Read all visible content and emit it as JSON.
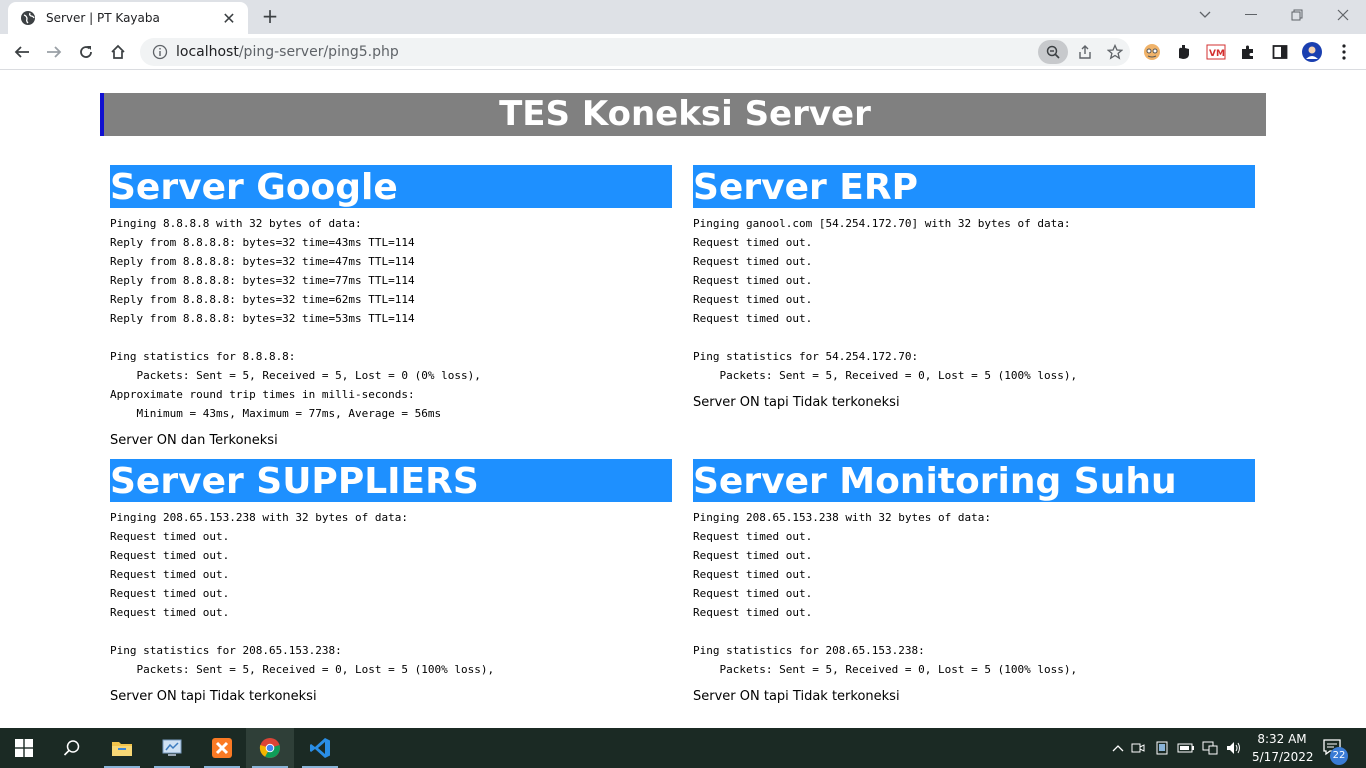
{
  "browser": {
    "tab_title": "Server | PT Kayaba",
    "url_host": "localhost",
    "url_path": "/ping-server/ping5.php"
  },
  "page": {
    "title": "TES Koneksi Server",
    "servers": [
      {
        "name": "Server Google",
        "output": "Pinging 8.8.8.8 with 32 bytes of data:\nReply from 8.8.8.8: bytes=32 time=43ms TTL=114\nReply from 8.8.8.8: bytes=32 time=47ms TTL=114\nReply from 8.8.8.8: bytes=32 time=77ms TTL=114\nReply from 8.8.8.8: bytes=32 time=62ms TTL=114\nReply from 8.8.8.8: bytes=32 time=53ms TTL=114\n\nPing statistics for 8.8.8.8:\n    Packets: Sent = 5, Received = 5, Lost = 0 (0% loss),\nApproximate round trip times in milli-seconds:\n    Minimum = 43ms, Maximum = 77ms, Average = 56ms",
        "status": "Server ON dan Terkoneksi"
      },
      {
        "name": "Server ERP",
        "output": "Pinging ganool.com [54.254.172.70] with 32 bytes of data:\nRequest timed out.\nRequest timed out.\nRequest timed out.\nRequest timed out.\nRequest timed out.\n\nPing statistics for 54.254.172.70:\n    Packets: Sent = 5, Received = 0, Lost = 5 (100% loss),",
        "status": "Server ON tapi Tidak terkoneksi"
      },
      {
        "name": "Server SUPPLIERS",
        "output": "Pinging 208.65.153.238 with 32 bytes of data:\nRequest timed out.\nRequest timed out.\nRequest timed out.\nRequest timed out.\nRequest timed out.\n\nPing statistics for 208.65.153.238:\n    Packets: Sent = 5, Received = 0, Lost = 5 (100% loss),",
        "status": "Server ON tapi Tidak terkoneksi"
      },
      {
        "name": "Server Monitoring Suhu",
        "output": "Pinging 208.65.153.238 with 32 bytes of data:\nRequest timed out.\nRequest timed out.\nRequest timed out.\nRequest timed out.\nRequest timed out.\n\nPing statistics for 208.65.153.238:\n    Packets: Sent = 5, Received = 0, Lost = 5 (100% loss),",
        "status": "Server ON tapi Tidak terkoneksi"
      }
    ]
  },
  "taskbar": {
    "time": "8:32 AM",
    "date": "5/17/2022",
    "notification_count": "22"
  },
  "colors": {
    "banner_bg": "#808080",
    "banner_border": "#1010d0",
    "card_header_bg": "#1e90ff"
  }
}
